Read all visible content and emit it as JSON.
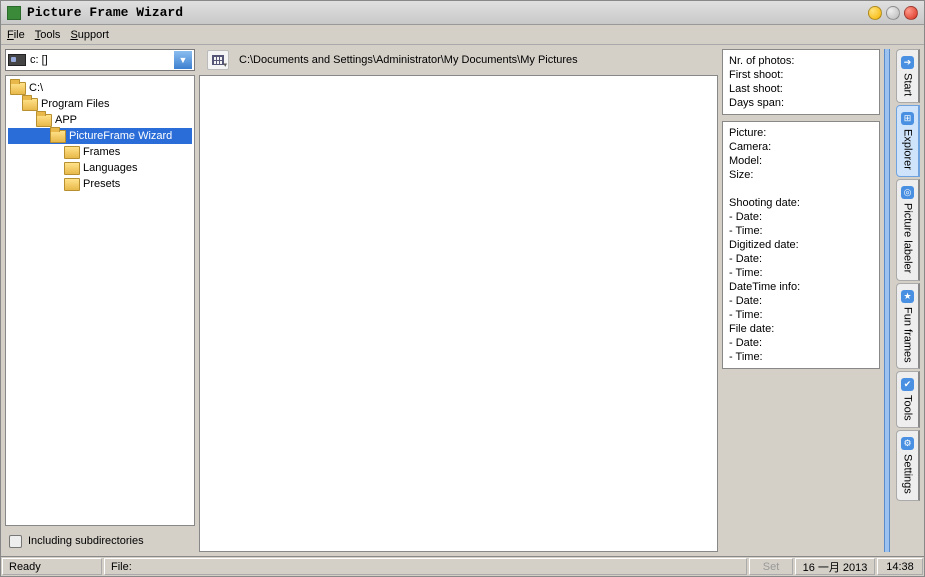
{
  "window": {
    "title": "Picture Frame Wizard"
  },
  "menu": {
    "file": "File",
    "tools": "Tools",
    "support": "Support"
  },
  "drive": {
    "label": "c: []"
  },
  "tree": {
    "n0": "C:\\",
    "n1": "Program Files",
    "n2": "APP",
    "n3": "PictureFrame Wizard",
    "n4": "Frames",
    "n5": "Languages",
    "n6": "Presets"
  },
  "subdir": {
    "label": "Including subdirectories"
  },
  "path": {
    "text": "C:\\Documents and Settings\\Administrator\\My Documents\\My Pictures"
  },
  "summary": {
    "l0": "Nr. of photos:",
    "l1": "First shoot:",
    "l2": "Last shoot:",
    "l3": "Days span:"
  },
  "details": {
    "l0": "Picture:",
    "l1": "Camera:",
    "l2": "Model:",
    "l3": "Size:",
    "l4": "",
    "l5": "Shooting date:",
    "l6": "- Date:",
    "l7": "- Time:",
    "l8": "Digitized date:",
    "l9": "- Date:",
    "l10": "- Time:",
    "l11": "DateTime info:",
    "l12": "- Date:",
    "l13": "- Time:",
    "l14": "File date:",
    "l15": "- Date:",
    "l16": "- Time:"
  },
  "tabs": {
    "t0": "Start",
    "t1": "Explorer",
    "t2": "Picture labeler",
    "t3": "Fun frames",
    "t4": "Tools",
    "t5": "Settings"
  },
  "status": {
    "ready": "Ready",
    "file_label": "File:",
    "set": "Set",
    "date": "16 一月 2013",
    "time": "14:38"
  }
}
